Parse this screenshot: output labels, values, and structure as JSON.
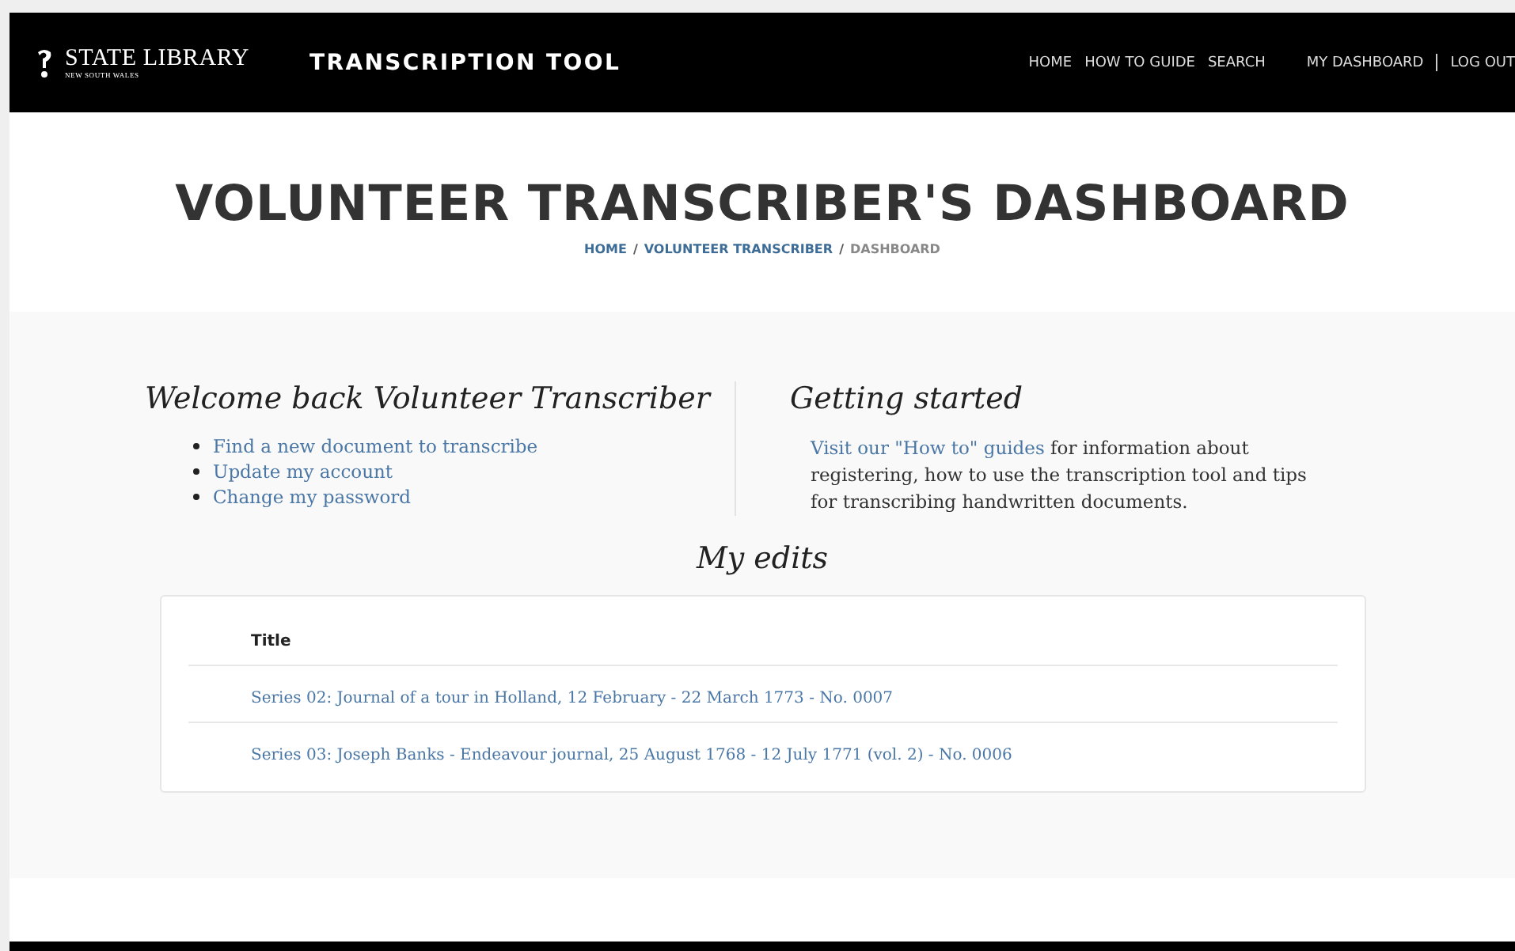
{
  "header": {
    "logo": {
      "name": "STATE LIBRARY",
      "subtitle": "NEW SOUTH WALES"
    },
    "app_title": "TRANSCRIPTION TOOL",
    "nav": [
      {
        "label": "HOME"
      },
      {
        "label": "HOW TO GUIDE"
      },
      {
        "label": "SEARCH"
      }
    ],
    "account_nav": [
      {
        "label": "MY DASHBOARD"
      },
      {
        "label": "LOG OUT"
      }
    ]
  },
  "page_title": "VOLUNTEER TRANSCRIBER'S DASHBOARD",
  "breadcrumb": [
    {
      "kind": "link",
      "label": "HOME"
    },
    {
      "kind": "separator",
      "label": "/"
    },
    {
      "kind": "link",
      "label": "VOLUNTEER TRANSCRIBER"
    },
    {
      "kind": "separator",
      "label": "/"
    },
    {
      "kind": "current",
      "label": "DASHBOARD"
    }
  ],
  "welcome": {
    "heading": "Welcome back Volunteer Transcriber",
    "links": [
      "Find a new document to transcribe",
      "Update my account",
      "Change my password"
    ]
  },
  "getting_started": {
    "heading": "Getting started",
    "link": "Visit our \"How to\" guides",
    "text": " for information about registering, how to use the transcription tool and tips for transcribing handwritten documents."
  },
  "my_edits": {
    "heading": "My edits",
    "columns": [
      "Title"
    ],
    "rows": [
      "Series 02: Journal of a tour in Holland, 12 February - 22 March 1773 - No. 0007",
      "Series 03: Joseph Banks - Endeavour journal, 25 August 1768 - 12 July 1771 (vol. 2) - No. 0006"
    ]
  }
}
